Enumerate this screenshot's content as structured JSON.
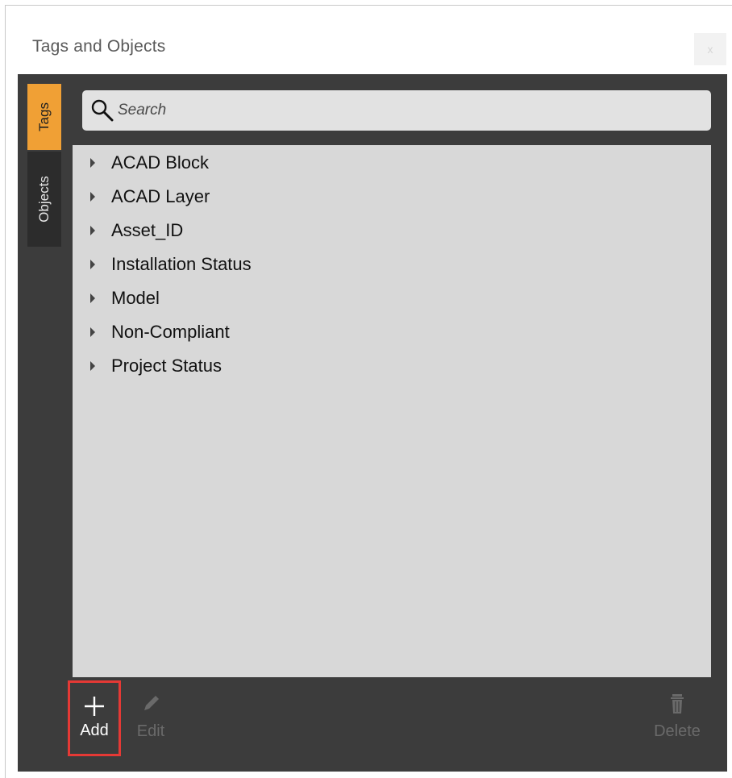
{
  "window": {
    "title": "Tags and Objects",
    "close_label": "x"
  },
  "sidebar": {
    "tabs": [
      {
        "label": "Tags",
        "active": true
      },
      {
        "label": "Objects",
        "active": false
      }
    ]
  },
  "search": {
    "placeholder": "Search",
    "value": ""
  },
  "tree": {
    "items": [
      {
        "label": "ACAD Block"
      },
      {
        "label": "ACAD Layer"
      },
      {
        "label": "Asset_ID"
      },
      {
        "label": "Installation Status"
      },
      {
        "label": "Model"
      },
      {
        "label": "Non-Compliant"
      },
      {
        "label": "Project Status"
      }
    ]
  },
  "toolbar": {
    "add_label": "Add",
    "edit_label": "Edit",
    "delete_label": "Delete"
  },
  "colors": {
    "accent_tab": "#f0a035",
    "panel_bg": "#3c3c3c",
    "list_bg": "#d8d8d8",
    "highlight_box": "#e53935"
  }
}
